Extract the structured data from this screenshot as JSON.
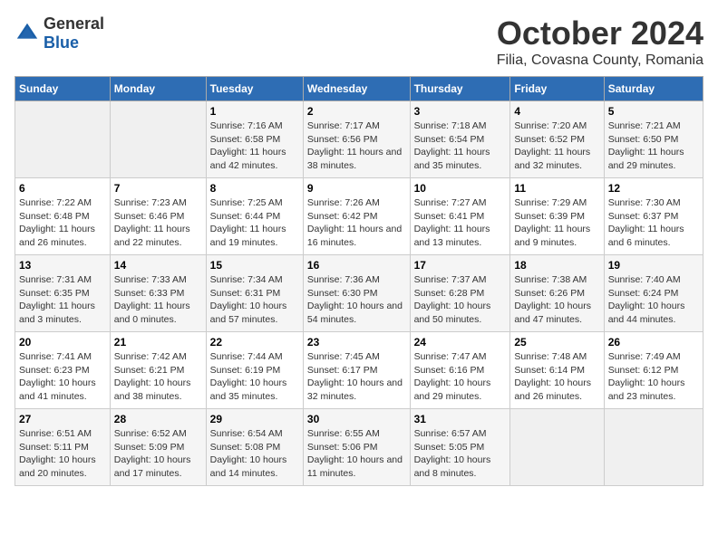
{
  "header": {
    "logo_general": "General",
    "logo_blue": "Blue",
    "month": "October 2024",
    "location": "Filia, Covasna County, Romania"
  },
  "weekdays": [
    "Sunday",
    "Monday",
    "Tuesday",
    "Wednesday",
    "Thursday",
    "Friday",
    "Saturday"
  ],
  "weeks": [
    [
      {
        "day": "",
        "sunrise": "",
        "sunset": "",
        "daylight": "",
        "empty": true
      },
      {
        "day": "",
        "sunrise": "",
        "sunset": "",
        "daylight": "",
        "empty": true
      },
      {
        "day": "1",
        "sunrise": "Sunrise: 7:16 AM",
        "sunset": "Sunset: 6:58 PM",
        "daylight": "Daylight: 11 hours and 42 minutes."
      },
      {
        "day": "2",
        "sunrise": "Sunrise: 7:17 AM",
        "sunset": "Sunset: 6:56 PM",
        "daylight": "Daylight: 11 hours and 38 minutes."
      },
      {
        "day": "3",
        "sunrise": "Sunrise: 7:18 AM",
        "sunset": "Sunset: 6:54 PM",
        "daylight": "Daylight: 11 hours and 35 minutes."
      },
      {
        "day": "4",
        "sunrise": "Sunrise: 7:20 AM",
        "sunset": "Sunset: 6:52 PM",
        "daylight": "Daylight: 11 hours and 32 minutes."
      },
      {
        "day": "5",
        "sunrise": "Sunrise: 7:21 AM",
        "sunset": "Sunset: 6:50 PM",
        "daylight": "Daylight: 11 hours and 29 minutes."
      }
    ],
    [
      {
        "day": "6",
        "sunrise": "Sunrise: 7:22 AM",
        "sunset": "Sunset: 6:48 PM",
        "daylight": "Daylight: 11 hours and 26 minutes."
      },
      {
        "day": "7",
        "sunrise": "Sunrise: 7:23 AM",
        "sunset": "Sunset: 6:46 PM",
        "daylight": "Daylight: 11 hours and 22 minutes."
      },
      {
        "day": "8",
        "sunrise": "Sunrise: 7:25 AM",
        "sunset": "Sunset: 6:44 PM",
        "daylight": "Daylight: 11 hours and 19 minutes."
      },
      {
        "day": "9",
        "sunrise": "Sunrise: 7:26 AM",
        "sunset": "Sunset: 6:42 PM",
        "daylight": "Daylight: 11 hours and 16 minutes."
      },
      {
        "day": "10",
        "sunrise": "Sunrise: 7:27 AM",
        "sunset": "Sunset: 6:41 PM",
        "daylight": "Daylight: 11 hours and 13 minutes."
      },
      {
        "day": "11",
        "sunrise": "Sunrise: 7:29 AM",
        "sunset": "Sunset: 6:39 PM",
        "daylight": "Daylight: 11 hours and 9 minutes."
      },
      {
        "day": "12",
        "sunrise": "Sunrise: 7:30 AM",
        "sunset": "Sunset: 6:37 PM",
        "daylight": "Daylight: 11 hours and 6 minutes."
      }
    ],
    [
      {
        "day": "13",
        "sunrise": "Sunrise: 7:31 AM",
        "sunset": "Sunset: 6:35 PM",
        "daylight": "Daylight: 11 hours and 3 minutes."
      },
      {
        "day": "14",
        "sunrise": "Sunrise: 7:33 AM",
        "sunset": "Sunset: 6:33 PM",
        "daylight": "Daylight: 11 hours and 0 minutes."
      },
      {
        "day": "15",
        "sunrise": "Sunrise: 7:34 AM",
        "sunset": "Sunset: 6:31 PM",
        "daylight": "Daylight: 10 hours and 57 minutes."
      },
      {
        "day": "16",
        "sunrise": "Sunrise: 7:36 AM",
        "sunset": "Sunset: 6:30 PM",
        "daylight": "Daylight: 10 hours and 54 minutes."
      },
      {
        "day": "17",
        "sunrise": "Sunrise: 7:37 AM",
        "sunset": "Sunset: 6:28 PM",
        "daylight": "Daylight: 10 hours and 50 minutes."
      },
      {
        "day": "18",
        "sunrise": "Sunrise: 7:38 AM",
        "sunset": "Sunset: 6:26 PM",
        "daylight": "Daylight: 10 hours and 47 minutes."
      },
      {
        "day": "19",
        "sunrise": "Sunrise: 7:40 AM",
        "sunset": "Sunset: 6:24 PM",
        "daylight": "Daylight: 10 hours and 44 minutes."
      }
    ],
    [
      {
        "day": "20",
        "sunrise": "Sunrise: 7:41 AM",
        "sunset": "Sunset: 6:23 PM",
        "daylight": "Daylight: 10 hours and 41 minutes."
      },
      {
        "day": "21",
        "sunrise": "Sunrise: 7:42 AM",
        "sunset": "Sunset: 6:21 PM",
        "daylight": "Daylight: 10 hours and 38 minutes."
      },
      {
        "day": "22",
        "sunrise": "Sunrise: 7:44 AM",
        "sunset": "Sunset: 6:19 PM",
        "daylight": "Daylight: 10 hours and 35 minutes."
      },
      {
        "day": "23",
        "sunrise": "Sunrise: 7:45 AM",
        "sunset": "Sunset: 6:17 PM",
        "daylight": "Daylight: 10 hours and 32 minutes."
      },
      {
        "day": "24",
        "sunrise": "Sunrise: 7:47 AM",
        "sunset": "Sunset: 6:16 PM",
        "daylight": "Daylight: 10 hours and 29 minutes."
      },
      {
        "day": "25",
        "sunrise": "Sunrise: 7:48 AM",
        "sunset": "Sunset: 6:14 PM",
        "daylight": "Daylight: 10 hours and 26 minutes."
      },
      {
        "day": "26",
        "sunrise": "Sunrise: 7:49 AM",
        "sunset": "Sunset: 6:12 PM",
        "daylight": "Daylight: 10 hours and 23 minutes."
      }
    ],
    [
      {
        "day": "27",
        "sunrise": "Sunrise: 6:51 AM",
        "sunset": "Sunset: 5:11 PM",
        "daylight": "Daylight: 10 hours and 20 minutes."
      },
      {
        "day": "28",
        "sunrise": "Sunrise: 6:52 AM",
        "sunset": "Sunset: 5:09 PM",
        "daylight": "Daylight: 10 hours and 17 minutes."
      },
      {
        "day": "29",
        "sunrise": "Sunrise: 6:54 AM",
        "sunset": "Sunset: 5:08 PM",
        "daylight": "Daylight: 10 hours and 14 minutes."
      },
      {
        "day": "30",
        "sunrise": "Sunrise: 6:55 AM",
        "sunset": "Sunset: 5:06 PM",
        "daylight": "Daylight: 10 hours and 11 minutes."
      },
      {
        "day": "31",
        "sunrise": "Sunrise: 6:57 AM",
        "sunset": "Sunset: 5:05 PM",
        "daylight": "Daylight: 10 hours and 8 minutes."
      },
      {
        "day": "",
        "sunrise": "",
        "sunset": "",
        "daylight": "",
        "empty": true
      },
      {
        "day": "",
        "sunrise": "",
        "sunset": "",
        "daylight": "",
        "empty": true
      }
    ]
  ]
}
